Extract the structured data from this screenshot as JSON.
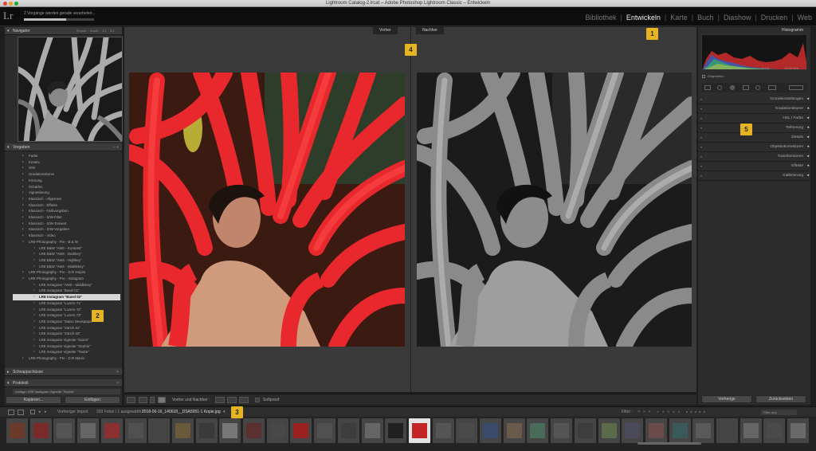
{
  "window": {
    "title": "Lightroom Catalog-2.lrcat – Adobe Photoshop Lightroom Classic – Entwickeln"
  },
  "identity": {
    "logo": "Lr",
    "status": "2 Vorgänge werden gerade verarbeitet...",
    "progress": 0.6
  },
  "modules": [
    "Bibliothek",
    "Entwickeln",
    "Karte",
    "Buch",
    "Diashow",
    "Drucken",
    "Web"
  ],
  "active_module": "Entwickeln",
  "badges": [
    "1",
    "2",
    "3",
    "4",
    "5"
  ],
  "navigator": {
    "title": "Navigator",
    "zoom": [
      "Einpas.",
      "Ausfü.",
      "1:1",
      "3:1"
    ]
  },
  "presets": {
    "title": "Vorgaben",
    "ctrl": "– +",
    "items": [
      {
        "label": "Farbe",
        "kind": "folder"
      },
      {
        "label": "Kreativ",
        "kind": "folder"
      },
      {
        "label": "S/W",
        "kind": "folder"
      },
      {
        "label": "Gradationskurve",
        "kind": "folder"
      },
      {
        "label": "Körnung",
        "kind": "folder"
      },
      {
        "label": "Schärfen",
        "kind": "folder"
      },
      {
        "label": "Vignettierung",
        "kind": "folder"
      },
      {
        "label": "Klassisch - Allgemein",
        "kind": "folder"
      },
      {
        "label": "Klassisch - Effekte",
        "kind": "folder"
      },
      {
        "label": "Klassisch - Farbvorgaben",
        "kind": "folder"
      },
      {
        "label": "Klassisch - S/W-Filter",
        "kind": "folder"
      },
      {
        "label": "Klassisch - S/W-Tonwert",
        "kind": "folder"
      },
      {
        "label": "Klassisch - S/W-Vorgaben",
        "kind": "folder"
      },
      {
        "label": "Klassisch - Video",
        "kind": "folder"
      },
      {
        "label": "LRE-Photography - Pre - B & W",
        "kind": "open"
      },
      {
        "label": "LRE B&W \"AMS - Kontrast\"",
        "kind": "preset"
      },
      {
        "label": "LRE B&W \"AMS - Darkkey\"",
        "kind": "preset"
      },
      {
        "label": "LRE B&W \"AMS - Highkey\"",
        "kind": "preset"
      },
      {
        "label": "LRE B&W \"AMS - Middlekey\"",
        "kind": "preset"
      },
      {
        "label": "LRE-Photography - Pre - D.R Inspire",
        "kind": "folder"
      },
      {
        "label": "LRE-Photography - Pre - Instagram",
        "kind": "open"
      },
      {
        "label": "LRE Instagram \"AMS - Middlekey\"",
        "kind": "preset"
      },
      {
        "label": "LRE Instagram \"Basel 01\"",
        "kind": "preset"
      },
      {
        "label": "LRE Instagram \"Basel 02\"",
        "kind": "preset",
        "selected": true
      },
      {
        "label": "LRE Instagram \"Luzern 71\"",
        "kind": "preset"
      },
      {
        "label": "LRE Instagram \"Luzern 72\"",
        "kind": "preset"
      },
      {
        "label": "LRE Instagram \"Luzern 73\"",
        "kind": "preset"
      },
      {
        "label": "LRE Instagram \"Swiss Newspaper\"",
        "kind": "preset"
      },
      {
        "label": "LRE Instagram \"Zürich 61\"",
        "kind": "preset"
      },
      {
        "label": "LRE Instagram \"Zürich 63\"",
        "kind": "preset"
      },
      {
        "label": "LRE Instagram Vignette \"Dunst\"",
        "kind": "preset"
      },
      {
        "label": "LRE Instagram Vignette \"Sephia\"",
        "kind": "preset"
      },
      {
        "label": "LRE Instagram Vignette \"Taube\"",
        "kind": "preset"
      },
      {
        "label": "LRE-Photography - Pre - D.R Manic",
        "kind": "folder"
      }
    ]
  },
  "snapshots": {
    "title": "Schnappschüsse",
    "ctrl": "+"
  },
  "history": {
    "title": "Protokoll",
    "ctrl": "×",
    "entry": "Vorlage: LRE Instagram Vignette \"Sephia\""
  },
  "left_buttons": {
    "copy": "Kopieren...",
    "paste": "Einfügen"
  },
  "view_tabs": {
    "before": "Vorher",
    "after": "Nachher"
  },
  "toolbar": {
    "before_after": "Vorher und Nachher :",
    "softproof": "Softproof"
  },
  "histogram": {
    "title": "Histogramm",
    "values": [
      "ISO 100",
      "100 mm",
      "f / 2,8",
      "1/1250 Sek."
    ],
    "original": "Originalfoto"
  },
  "right_sections": [
    "Grundeinstellungen",
    "Gradationskurve",
    "HSL / Farbe",
    "Teiltonung",
    "Details",
    "Objektivkorrekturen",
    "Transformieren",
    "Effekte",
    "Kalibrierung"
  ],
  "right_buttons": {
    "previous": "Vorherige",
    "reset": "Zurücksetzen"
  },
  "filmstrip_bar": {
    "path": "Vorheriger Import",
    "count": "333 Fotos / 1 ausgewählt /",
    "file": "2018-06-16_140618__DSA5951-1 Kopie.jpg",
    "arrow": "▾",
    "filter": "Filter :",
    "filter_value": "Filter aus"
  }
}
